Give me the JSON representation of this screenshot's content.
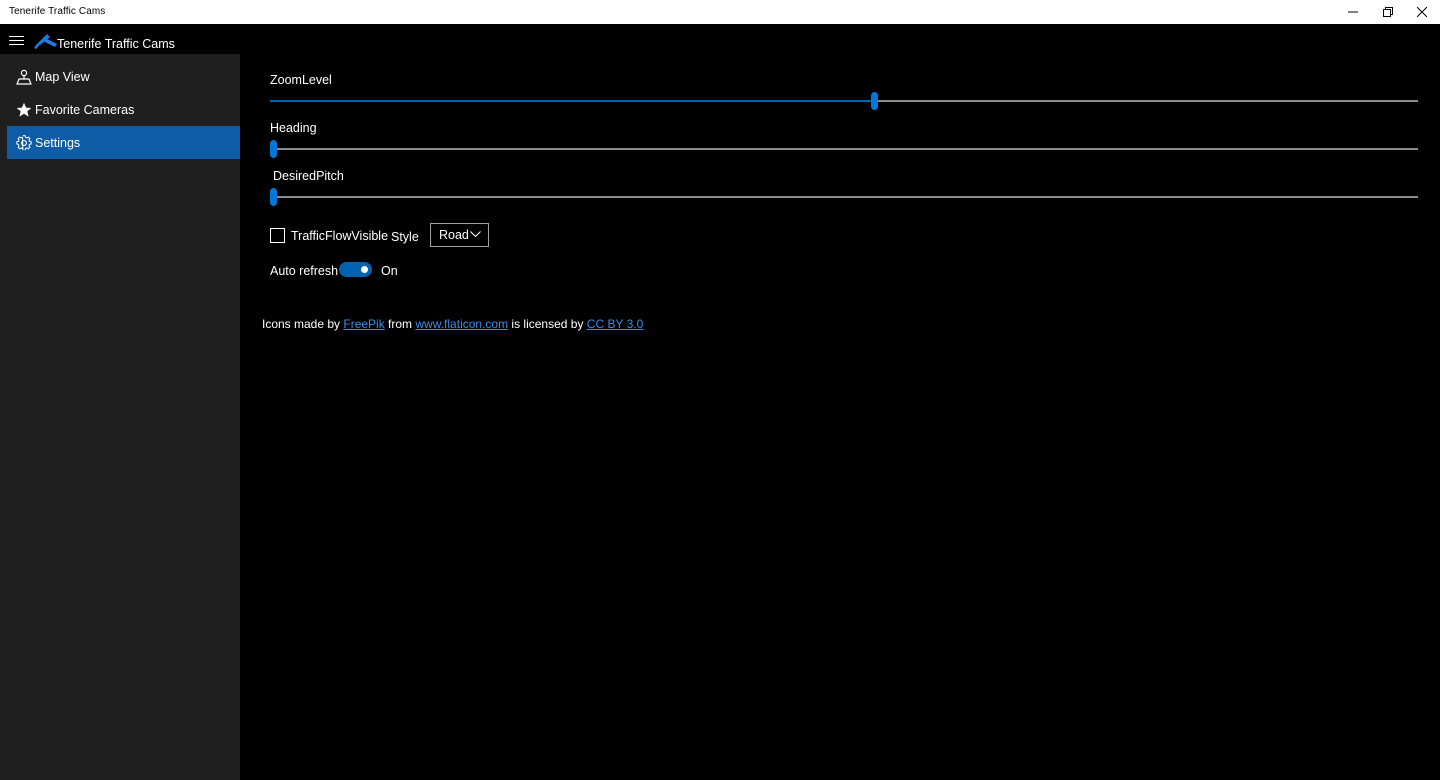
{
  "window": {
    "title": "Tenerife Traffic Cams"
  },
  "header": {
    "app_title": "Tenerife Traffic Cams"
  },
  "sidebar": {
    "items": [
      {
        "label": "Map View",
        "icon": "map-pin-icon"
      },
      {
        "label": "Favorite Cameras",
        "icon": "star-icon"
      },
      {
        "label": "Settings",
        "icon": "gear-icon",
        "selected": true
      }
    ]
  },
  "settings": {
    "zoom": {
      "label": "ZoomLevel",
      "value_fraction": 0.526
    },
    "heading": {
      "label": "Heading",
      "value_fraction": 0.0
    },
    "pitch": {
      "label": "DesiredPitch",
      "value_fraction": 0.0
    },
    "traffic_flow": {
      "label": "TrafficFlowVisible",
      "checked": false
    },
    "style": {
      "label": "Style",
      "selected": "Road"
    },
    "auto_refresh": {
      "label": "Auto refresh",
      "state": "On",
      "on": true
    }
  },
  "credits": {
    "text1": "Icons made by ",
    "link1": "FreePik",
    "text2": " from ",
    "link2": "www.flaticon.com",
    "text3": " is licensed by ",
    "link3": "CC BY 3.0"
  },
  "colors": {
    "accent": "#0078d7",
    "selection": "#0e5ba6",
    "link": "#3c8be8",
    "sidebar_bg": "#1f1f1f"
  }
}
